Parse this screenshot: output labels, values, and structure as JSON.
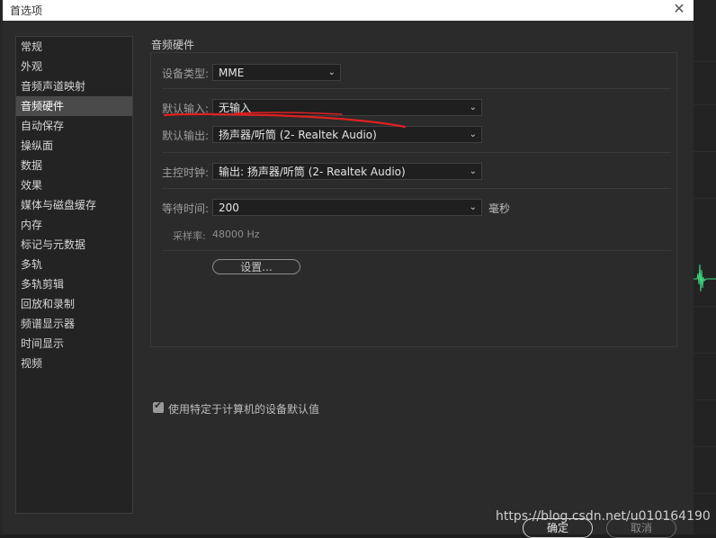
{
  "window": {
    "title": "首选项"
  },
  "sidebar": {
    "items": [
      {
        "label": "常规"
      },
      {
        "label": "外观"
      },
      {
        "label": "音频声道映射"
      },
      {
        "label": "音频硬件"
      },
      {
        "label": "自动保存"
      },
      {
        "label": "操纵面"
      },
      {
        "label": "数据"
      },
      {
        "label": "效果"
      },
      {
        "label": "媒体与磁盘缓存"
      },
      {
        "label": "内存"
      },
      {
        "label": "标记与元数据"
      },
      {
        "label": "多轨"
      },
      {
        "label": "多轨剪辑"
      },
      {
        "label": "回放和录制"
      },
      {
        "label": "频谱显示器"
      },
      {
        "label": "时间显示"
      },
      {
        "label": "视频"
      }
    ],
    "selected": "音频硬件"
  },
  "audio_hardware": {
    "section_title": "音频硬件",
    "device_type_label": "设备类型:",
    "device_type_value": "MME",
    "default_input_label": "默认输入:",
    "default_input_value": "无输入",
    "default_output_label": "默认输出:",
    "default_output_value": "扬声器/听筒 (2- Realtek Audio)",
    "master_clock_label": "主控时钟:",
    "master_clock_value": "输出: 扬声器/听筒 (2- Realtek Audio)",
    "latency_label": "等待时间:",
    "latency_value": "200",
    "latency_unit": "毫秒",
    "sample_rate_label": "采样率:",
    "sample_rate_value": "48000 Hz",
    "settings_button": "设置..."
  },
  "options": {
    "use_computer_defaults_label": "使用特定于计算机的设备默认值",
    "use_computer_defaults_checked": true
  },
  "footer": {
    "ok_label": "确定",
    "cancel_label": "取消"
  },
  "watermark": "https://blog.csdn.net/u010164190",
  "colors": {
    "dialog_bg": "#2b2b2b",
    "selected_item_bg": "#4a4a4a",
    "annotation_red": "#e02020",
    "waveform_green": "#3ddc84"
  }
}
